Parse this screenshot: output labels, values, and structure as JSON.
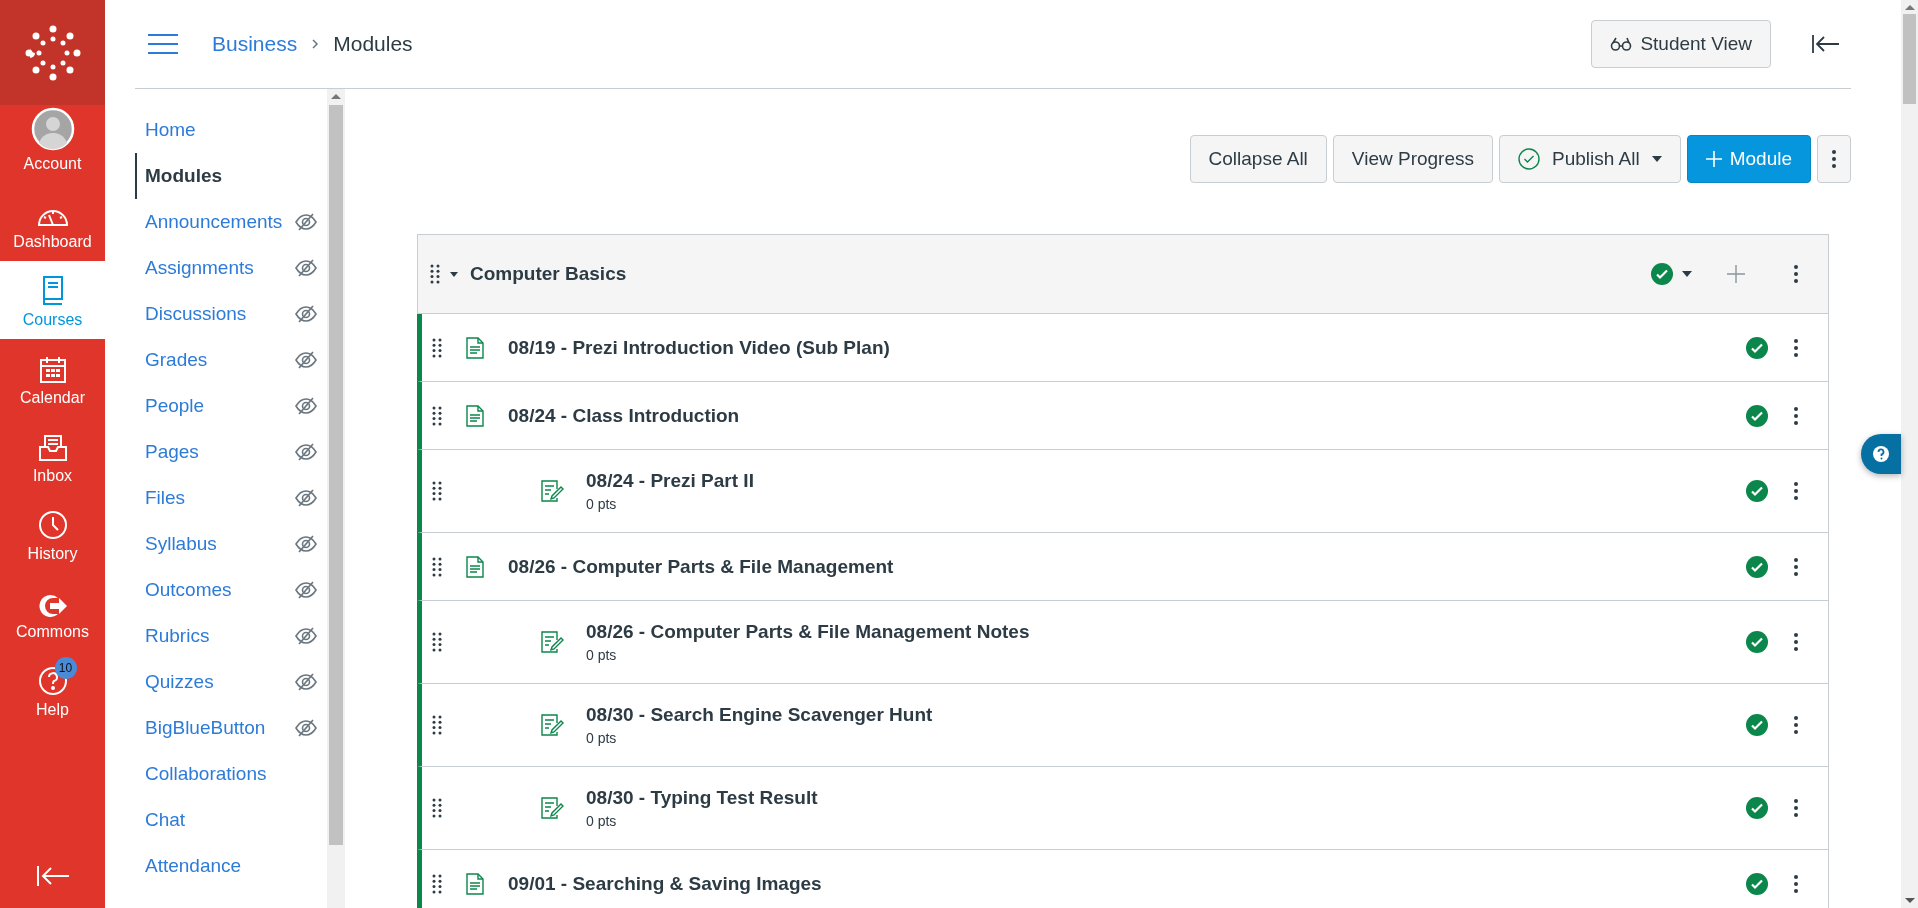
{
  "global_nav": [
    {
      "kind": "account",
      "label": "Account",
      "selected": false
    },
    {
      "kind": "dashboard",
      "label": "Dashboard",
      "selected": false
    },
    {
      "kind": "courses",
      "label": "Courses",
      "selected": true
    },
    {
      "kind": "calendar",
      "label": "Calendar",
      "selected": false
    },
    {
      "kind": "inbox",
      "label": "Inbox",
      "selected": false
    },
    {
      "kind": "history",
      "label": "History",
      "selected": false
    },
    {
      "kind": "commons",
      "label": "Commons",
      "selected": false
    },
    {
      "kind": "help",
      "label": "Help",
      "selected": false,
      "badge": "10"
    }
  ],
  "breadcrumb": [
    "Business",
    "Modules"
  ],
  "header_buttons": {
    "student_view": "Student View"
  },
  "course_nav": [
    {
      "label": "Home",
      "selected": false,
      "hidden": false
    },
    {
      "label": "Modules",
      "selected": true,
      "hidden": false
    },
    {
      "label": "Announcements",
      "selected": false,
      "hidden": true
    },
    {
      "label": "Assignments",
      "selected": false,
      "hidden": true
    },
    {
      "label": "Discussions",
      "selected": false,
      "hidden": true
    },
    {
      "label": "Grades",
      "selected": false,
      "hidden": true
    },
    {
      "label": "People",
      "selected": false,
      "hidden": true
    },
    {
      "label": "Pages",
      "selected": false,
      "hidden": true
    },
    {
      "label": "Files",
      "selected": false,
      "hidden": true
    },
    {
      "label": "Syllabus",
      "selected": false,
      "hidden": true
    },
    {
      "label": "Outcomes",
      "selected": false,
      "hidden": true
    },
    {
      "label": "Rubrics",
      "selected": false,
      "hidden": true
    },
    {
      "label": "Quizzes",
      "selected": false,
      "hidden": true
    },
    {
      "label": "BigBlueButton",
      "selected": false,
      "hidden": true
    },
    {
      "label": "Collaborations",
      "selected": false,
      "hidden": false
    },
    {
      "label": "Chat",
      "selected": false,
      "hidden": false
    },
    {
      "label": "Attendance",
      "selected": false,
      "hidden": false
    }
  ],
  "toolbar": {
    "collapse_all": "Collapse All",
    "view_progress": "View Progress",
    "publish_all": "Publish All",
    "add_module": "Module"
  },
  "module": {
    "title": "Computer Basics",
    "expanded": true,
    "published": true,
    "items": [
      {
        "kind": "page",
        "title": "08/19 - Prezi Introduction Video (Sub Plan)",
        "published": true
      },
      {
        "kind": "page",
        "title": "08/24 - Class Introduction",
        "published": true
      },
      {
        "kind": "assignment",
        "title": "08/24 - Prezi Part II",
        "points": "0 pts",
        "published": true
      },
      {
        "kind": "page",
        "title": "08/26 - Computer Parts & File Management",
        "published": true
      },
      {
        "kind": "assignment",
        "title": "08/26 - Computer Parts & File Management Notes",
        "points": "0 pts",
        "published": true
      },
      {
        "kind": "assignment",
        "title": "08/30 - Search Engine Scavenger Hunt",
        "points": "0 pts",
        "published": true
      },
      {
        "kind": "assignment",
        "title": "08/30 - Typing Test Result",
        "points": "0 pts",
        "published": true
      },
      {
        "kind": "page",
        "title": "09/01 - Searching & Saving Images",
        "published": true
      }
    ]
  }
}
